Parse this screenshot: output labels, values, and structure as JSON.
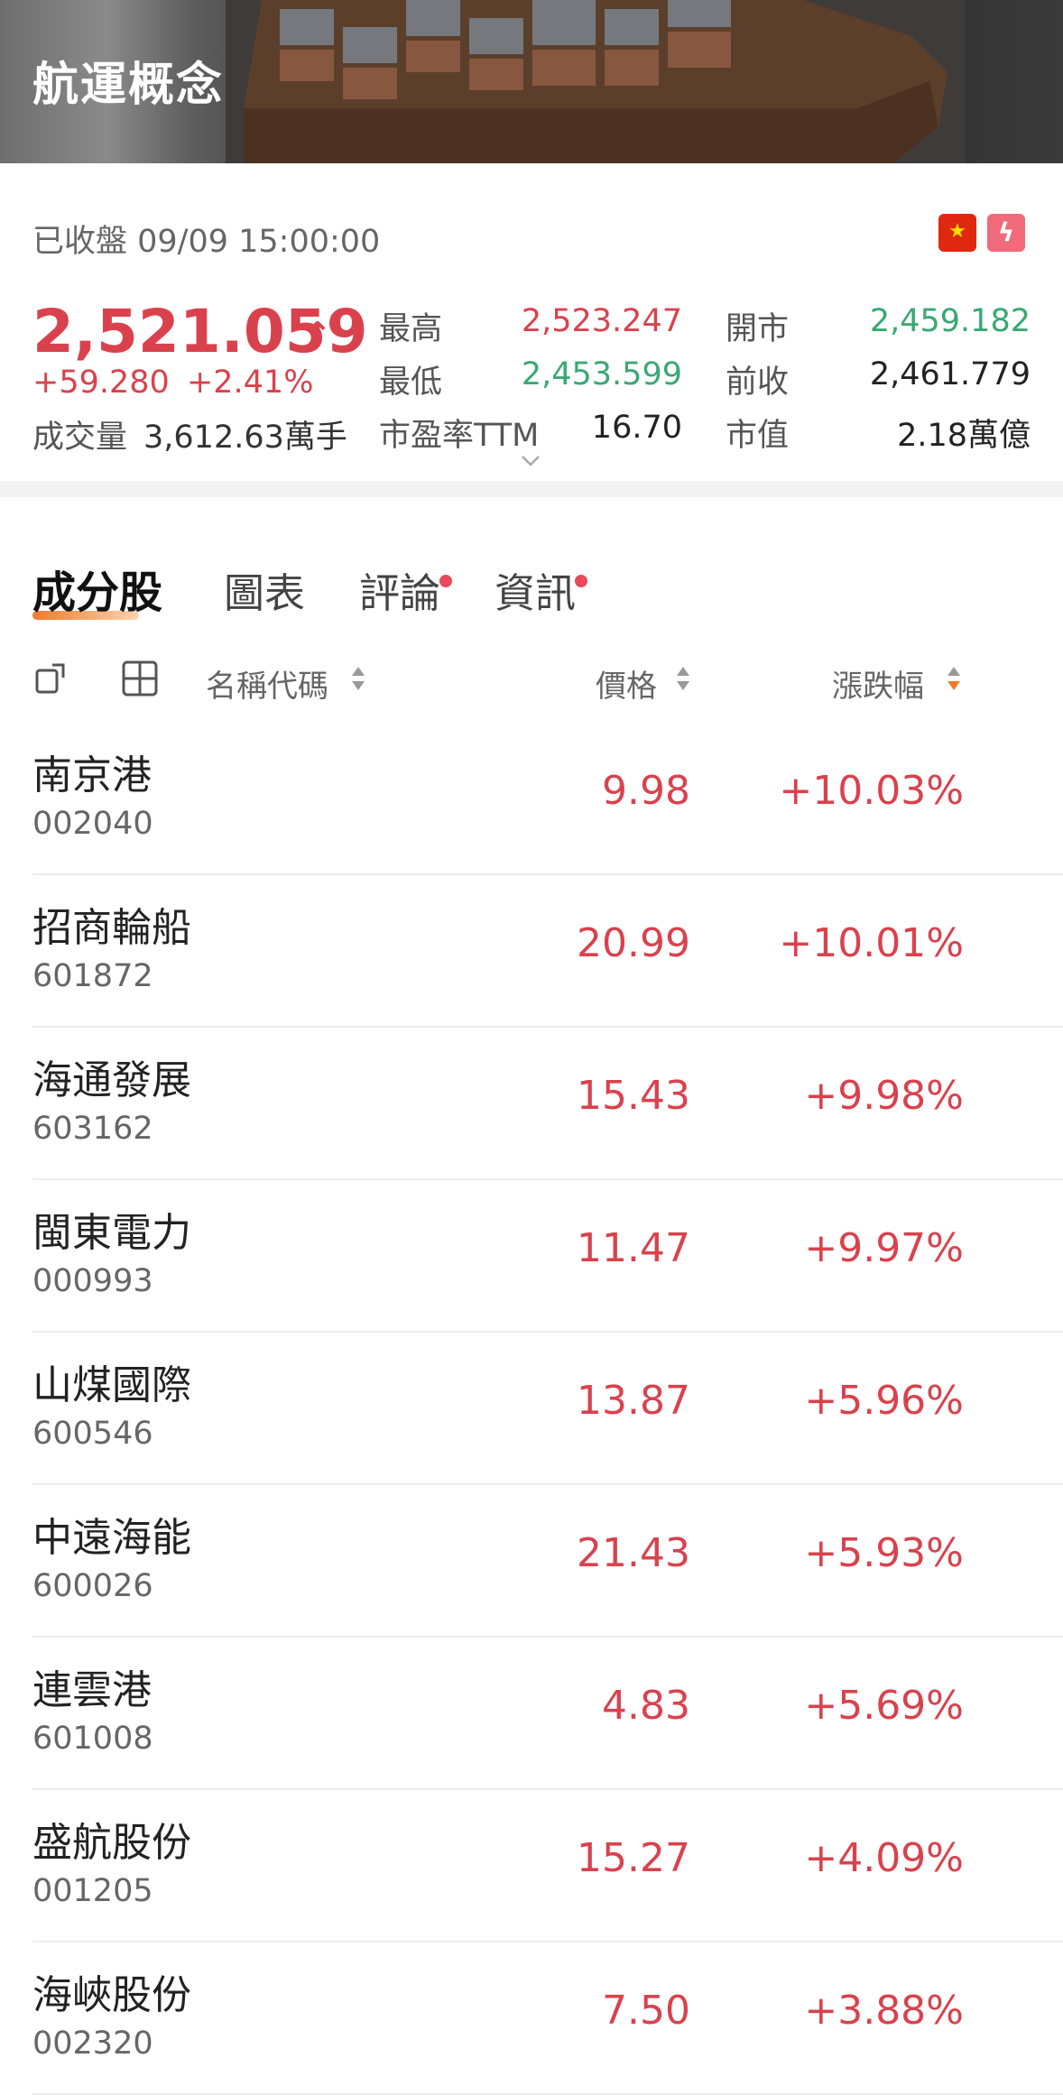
{
  "header": {
    "title": "航運概念"
  },
  "quote": {
    "status": "已收盤 09/09 15:00:00",
    "price": "2,521.059",
    "change": "+59.280",
    "change_pct": "+2.41%",
    "volume_label": "成交量",
    "volume_value": "3,612.63萬手",
    "stats": {
      "high_label": "最高",
      "high_value": "2,523.247",
      "low_label": "最低",
      "low_value": "2,453.599",
      "pe_label": "市盈率TTM",
      "pe_value": "16.70",
      "open_label": "開市",
      "open_value": "2,459.182",
      "prev_label": "前收",
      "prev_value": "2,461.779",
      "cap_label": "市值",
      "cap_value": "2.18萬億"
    },
    "colors": {
      "up": "#d9424d",
      "down": "#3aa874"
    }
  },
  "tabs": [
    {
      "label": "成分股",
      "active": true
    },
    {
      "label": "圖表"
    },
    {
      "label": "評論",
      "badge": true
    },
    {
      "label": "資訊",
      "badge": true
    }
  ],
  "columns": {
    "name": "名稱代碼",
    "price": "價格",
    "change": "漲跌幅"
  },
  "stocks": [
    {
      "name": "南京港",
      "code": "002040",
      "price": "9.98",
      "change": "+10.03%"
    },
    {
      "name": "招商輪船",
      "code": "601872",
      "price": "20.99",
      "change": "+10.01%"
    },
    {
      "name": "海通發展",
      "code": "603162",
      "price": "15.43",
      "change": "+9.98%"
    },
    {
      "name": "閩東電力",
      "code": "000993",
      "price": "11.47",
      "change": "+9.97%"
    },
    {
      "name": "山煤國際",
      "code": "600546",
      "price": "13.87",
      "change": "+5.96%"
    },
    {
      "name": "中遠海能",
      "code": "600026",
      "price": "21.43",
      "change": "+5.93%"
    },
    {
      "name": "連雲港",
      "code": "601008",
      "price": "4.83",
      "change": "+5.69%"
    },
    {
      "name": "盛航股份",
      "code": "001205",
      "price": "15.27",
      "change": "+4.09%"
    },
    {
      "name": "海峽股份",
      "code": "002320",
      "price": "7.50",
      "change": "+3.88%"
    }
  ]
}
